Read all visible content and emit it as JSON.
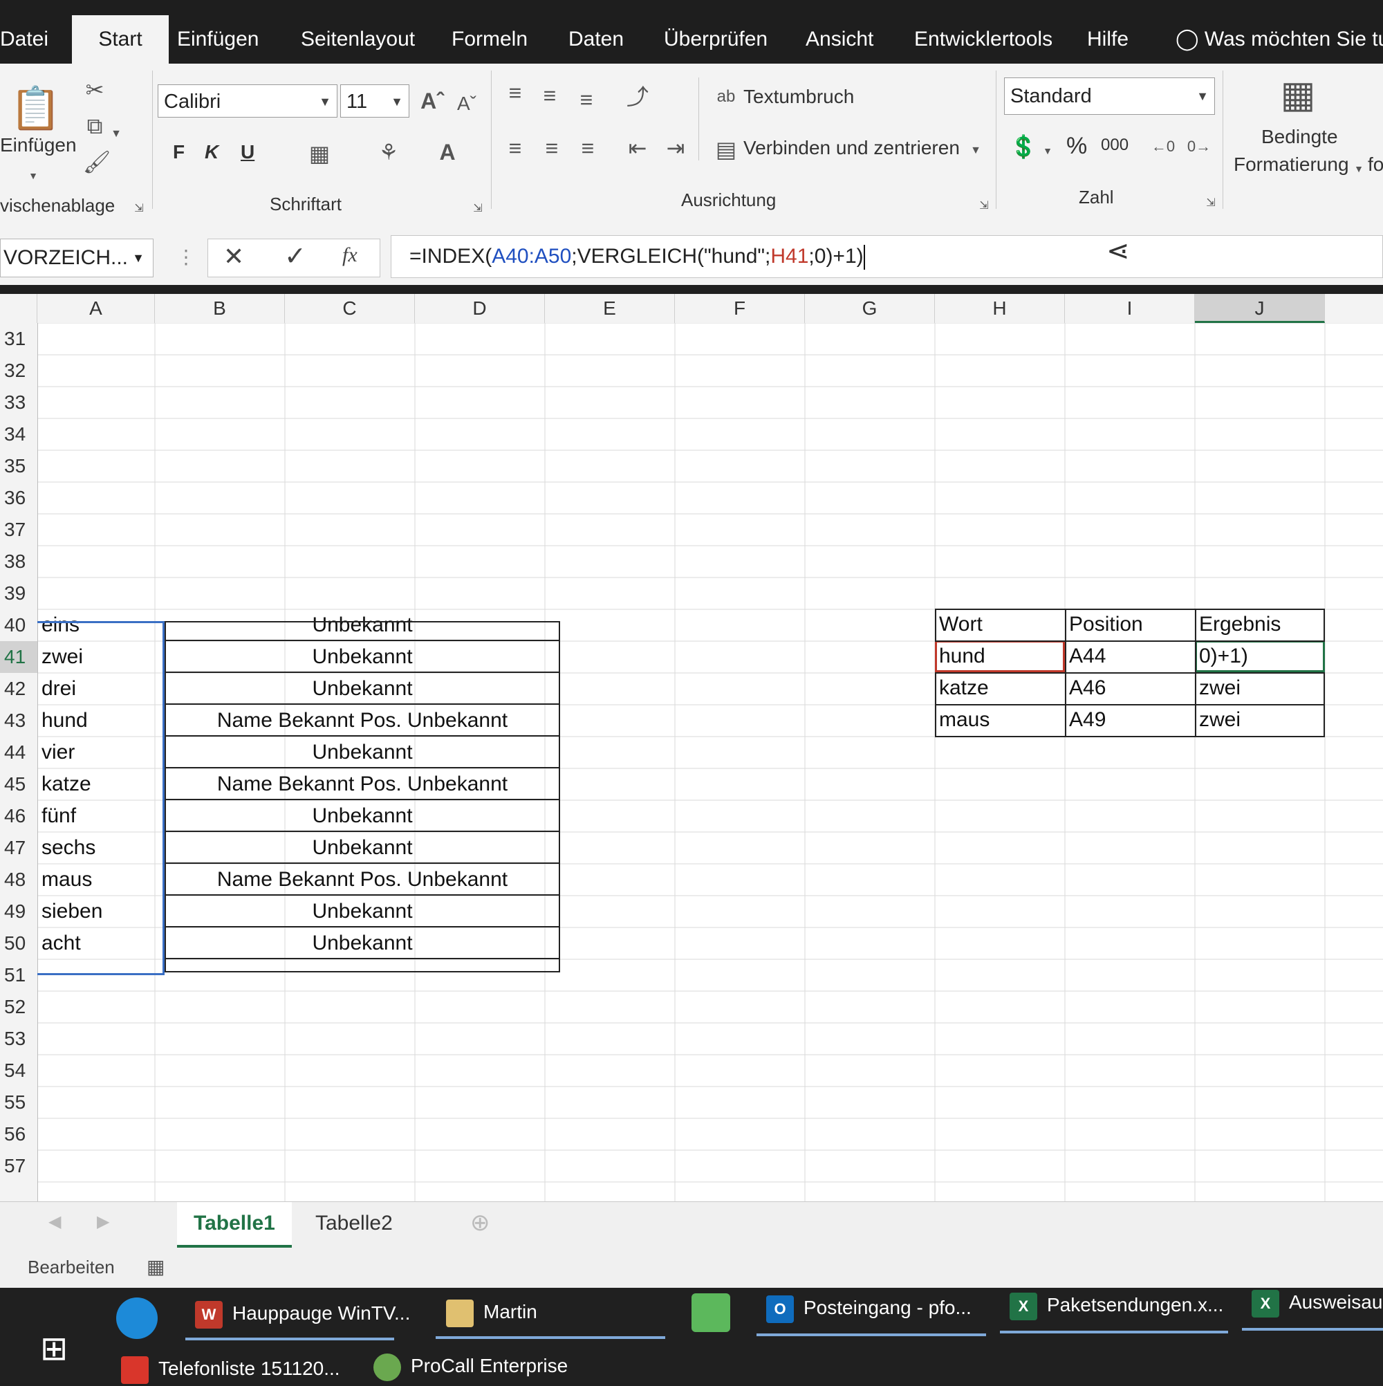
{
  "menu": {
    "tabs": [
      "Datei",
      "Start",
      "Einfügen",
      "Seitenlayout",
      "Formeln",
      "Daten",
      "Überprüfen",
      "Ansicht",
      "Entwicklertools",
      "Hilfe"
    ],
    "active": "Start",
    "tell_me": "Was möchten Sie tun"
  },
  "ribbon": {
    "paste_label": "Einfügen",
    "clipboard_group": "vischenablage",
    "font_name": "Calibri",
    "font_size": "11",
    "bold": "F",
    "italic": "K",
    "underline": "U",
    "font_group": "Schriftart",
    "wrap_text": "Textumbruch",
    "merge_center": "Verbinden und zentrieren",
    "alignment_group": "Ausrichtung",
    "number_format": "Standard",
    "percent": "%",
    "thousands": "000",
    "number_group": "Zahl",
    "cond_format_line1": "Bedingte",
    "cond_format_line2": "Formatierung",
    "cond_format_cut": "fo"
  },
  "formula_bar": {
    "name_box": "VORZEICH...",
    "formula_prefix": "=INDEX(",
    "formula_ref1": "A40:A50",
    "formula_mid": ";VERGLEICH(\"hund\";",
    "formula_ref2": "H41",
    "formula_suffix": ";0)+1)",
    "fx": "fx"
  },
  "columns": [
    "A",
    "B",
    "C",
    "D",
    "E",
    "F",
    "G",
    "H",
    "I",
    "J"
  ],
  "selected_column": "J",
  "rows": [
    "31",
    "32",
    "33",
    "34",
    "35",
    "36",
    "37",
    "38",
    "39",
    "40",
    "41",
    "42",
    "43",
    "44",
    "45",
    "46",
    "47",
    "48",
    "49",
    "50",
    "51",
    "52",
    "53",
    "54",
    "55",
    "56",
    "57"
  ],
  "col_a_values": [
    "eins",
    "zwei",
    "drei",
    "hund",
    "vier",
    "katze",
    "fünf",
    "sechs",
    "maus",
    "sieben",
    "acht"
  ],
  "col_c_values": [
    "Unbekannt",
    "Unbekannt",
    "Unbekannt",
    "Name Bekannt Pos. Unbekannt",
    "Unbekannt",
    "Name Bekannt Pos. Unbekannt",
    "Unbekannt",
    "Unbekannt",
    "Name Bekannt Pos. Unbekannt",
    "Unbekannt",
    "Unbekannt"
  ],
  "lookup_table": {
    "headers": [
      "Wort",
      "Position",
      "Ergebnis"
    ],
    "rows": [
      [
        "hund",
        "A44",
        "0)+1)"
      ],
      [
        "katze",
        "A46",
        "zwei"
      ],
      [
        "maus",
        "A49",
        "zwei"
      ]
    ]
  },
  "sheets": [
    "Tabelle1",
    "Tabelle2"
  ],
  "active_sheet": "Tabelle1",
  "status": "Bearbeiten",
  "taskbar": {
    "items": [
      "Hauppauge WinTV...",
      "Martin",
      "Posteingang - pfo...",
      "Paketsendungen.x...",
      "Ausweisaus"
    ],
    "items_row2": [
      "Telefonliste 151120...",
      "ProCall Enterprise"
    ]
  },
  "colors": {
    "excel_green": "#217346",
    "formula_ref_blue": "#1f4fc0",
    "formula_ref_red": "#c0392b",
    "selection_blue": "#3a6fc4"
  }
}
